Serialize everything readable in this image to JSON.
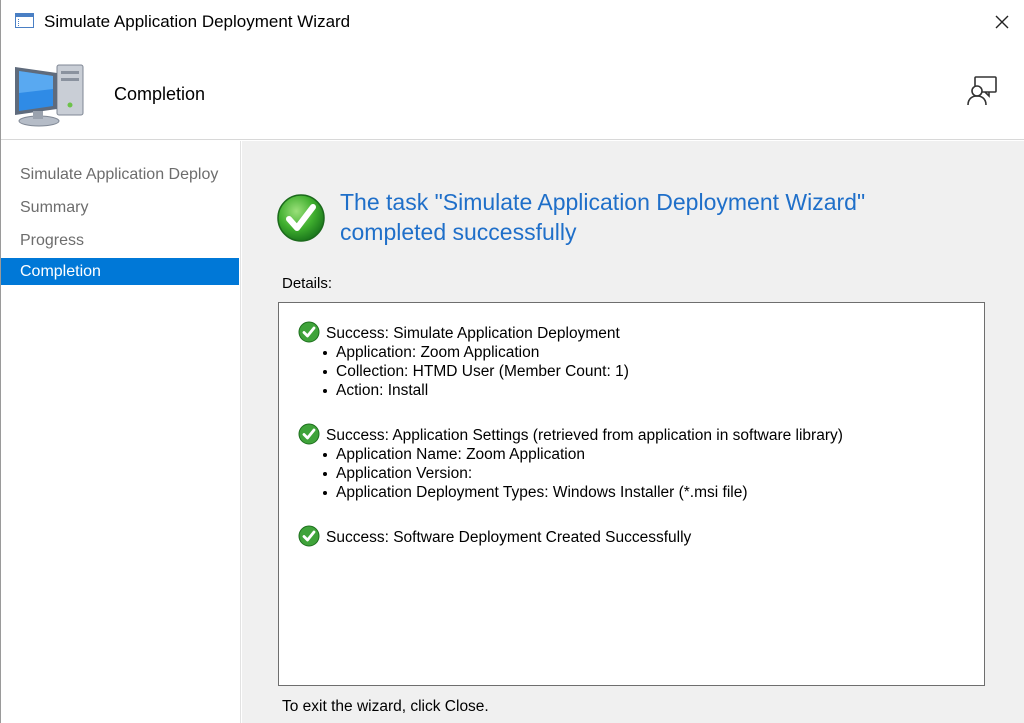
{
  "window": {
    "title": "Simulate Application Deployment Wizard"
  },
  "header": {
    "title": "Completion"
  },
  "sidebar": {
    "items": [
      {
        "label": "Simulate Application Deploy",
        "active": false
      },
      {
        "label": "Summary",
        "active": false
      },
      {
        "label": "Progress",
        "active": false
      },
      {
        "label": "Completion",
        "active": true
      }
    ]
  },
  "main": {
    "headline_line1": "The task \"Simulate Application Deployment Wizard\"",
    "headline_line2": "completed successfully",
    "details_label": "Details:",
    "entries": [
      {
        "title": "Success: Simulate Application Deployment",
        "bullets": [
          "Application: Zoom Application",
          "Collection: HTMD User (Member Count: 1)",
          "Action: Install"
        ]
      },
      {
        "title": "Success: Application Settings (retrieved from application in software library)",
        "bullets": [
          "Application Name: Zoom Application",
          "Application Version:",
          "Application Deployment Types: Windows Installer (*.msi file)"
        ]
      },
      {
        "title": "Success: Software Deployment Created Successfully",
        "bullets": []
      }
    ],
    "footer": "To exit the wizard, click Close."
  },
  "icons": {
    "title": "wizard-window-icon",
    "header": "computer-icon",
    "feedback": "feedback-icon",
    "close": "close-icon",
    "success": "check-circle-icon"
  },
  "colors": {
    "accent": "#0078d7",
    "headline": "#1f6fc9",
    "success": "#2e9b2e",
    "content_bg": "#f0f0f0"
  }
}
